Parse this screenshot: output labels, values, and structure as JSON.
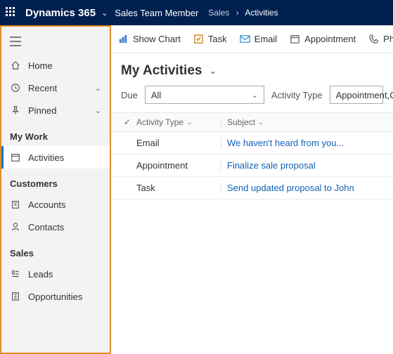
{
  "topbar": {
    "brand": "Dynamics 365",
    "area": "Sales Team Member",
    "breadcrumb": {
      "parent": "Sales",
      "current": "Activities"
    }
  },
  "sidebar": {
    "home": "Home",
    "recent": "Recent",
    "pinned": "Pinned",
    "sections": {
      "mywork": {
        "title": "My Work",
        "activities": "Activities"
      },
      "customers": {
        "title": "Customers",
        "accounts": "Accounts",
        "contacts": "Contacts"
      },
      "sales": {
        "title": "Sales",
        "leads": "Leads",
        "opportunities": "Opportunities"
      }
    }
  },
  "cmdbar": {
    "showchart": "Show Chart",
    "task": "Task",
    "email": "Email",
    "appointment": "Appointment",
    "phonecall": "Phone Call"
  },
  "view": {
    "title": "My Activities",
    "due_label": "Due",
    "due_value": "All",
    "acttype_label": "Activity Type",
    "acttype_value": "Appointment,C"
  },
  "grid": {
    "headers": {
      "type": "Activity Type",
      "subject": "Subject"
    },
    "rows": [
      {
        "type": "Email",
        "subject": "We haven't heard from you..."
      },
      {
        "type": "Appointment",
        "subject": "Finalize sale proposal"
      },
      {
        "type": "Task",
        "subject": "Send updated proposal to John"
      }
    ]
  }
}
